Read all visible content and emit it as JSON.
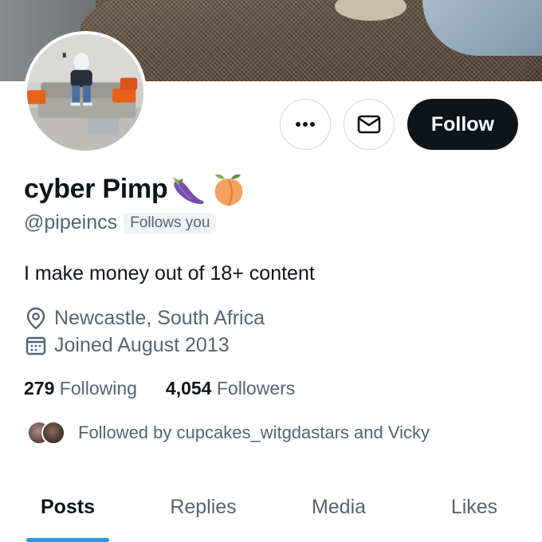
{
  "profile": {
    "display_name": "cyber Pimp",
    "name_emojis": [
      "eggplant-emoji",
      "peach-emoji"
    ],
    "handle": "@pipeincs",
    "follows_you_badge": "Follows you",
    "bio": "I make money out of 18+ content",
    "location": "Newcastle, South Africa",
    "joined": "Joined August 2013"
  },
  "actions": {
    "more_icon": "ellipsis-icon",
    "message_icon": "envelope-icon",
    "follow_label": "Follow"
  },
  "stats": {
    "following_count": "279",
    "following_label": "Following",
    "followers_count": "4,054",
    "followers_label": "Followers"
  },
  "followed_by": {
    "text": "Followed by cupcakes_witgdastars and Vicky"
  },
  "tabs": [
    {
      "label": "Posts",
      "active": true
    },
    {
      "label": "Replies",
      "active": false
    },
    {
      "label": "Media",
      "active": false
    },
    {
      "label": "Likes",
      "active": false
    }
  ],
  "colors": {
    "text_primary": "#0f1419",
    "text_secondary": "#536471",
    "accent": "#1d9bf0",
    "follow_button": "#0f1419"
  }
}
